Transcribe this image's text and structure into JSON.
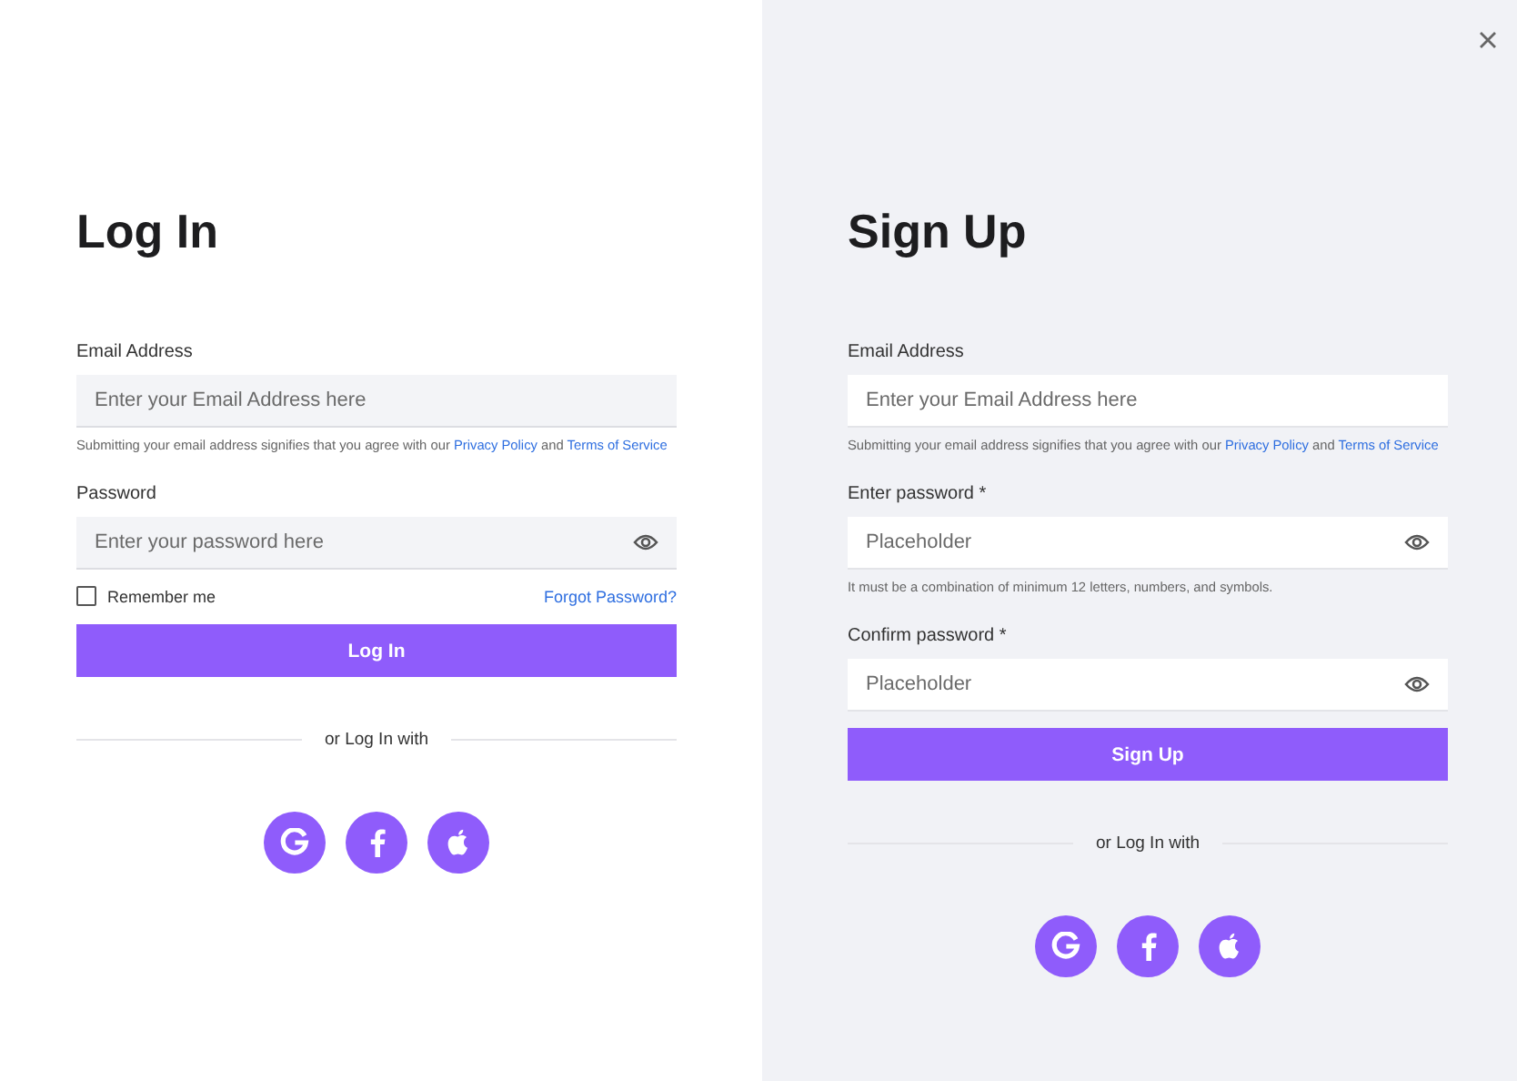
{
  "panels": [
    {
      "title": "Log In",
      "fields": [
        {
          "kind": "email",
          "label": "Email Address",
          "placeholder": "Enter your Email Address here",
          "consent": {
            "before": "Submitting your email address signifies that you agree with our",
            "link_1": "Privacy Policy",
            "between": "and",
            "link_2": "Terms of Service"
          }
        },
        {
          "kind": "password",
          "label": "Password",
          "placeholder": "Enter your password here"
        }
      ],
      "remember": {
        "label": "Remember me",
        "checked": false
      },
      "forgot_link": "Forgot Password?",
      "button": "Log In",
      "divider_text": "or Log In with",
      "socials": [
        {
          "kind": "google"
        },
        {
          "kind": "facebook"
        },
        {
          "kind": "apple"
        }
      ]
    },
    {
      "title": "Sign Up",
      "fields": [
        {
          "kind": "email",
          "label": "Email Address",
          "placeholder": "Enter your Email Address here",
          "consent": {
            "before": "Submitting your email address signifies that you agree with our",
            "link_1": "Privacy Policy",
            "between": "and",
            "link_2": "Terms of Service"
          }
        },
        {
          "kind": "password",
          "label": "Enter password *",
          "placeholder": "Placeholder",
          "hint": "It must be a combination of minimum 12 letters, numbers, and symbols."
        },
        {
          "kind": "password",
          "label": "Confirm password *",
          "placeholder": "Placeholder"
        }
      ],
      "button": "Sign Up",
      "divider_text": "or Log In with",
      "socials": [
        {
          "kind": "google"
        },
        {
          "kind": "facebook"
        },
        {
          "kind": "apple"
        }
      ]
    }
  ]
}
